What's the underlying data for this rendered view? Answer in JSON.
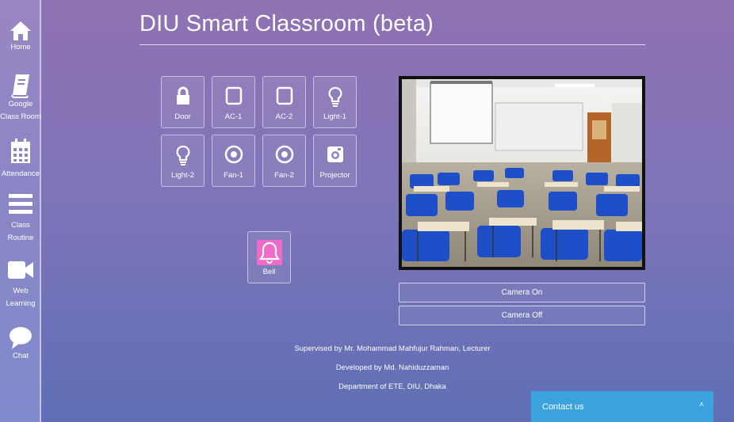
{
  "sidebar": {
    "items": [
      {
        "label": "Home",
        "icon": "home-icon"
      },
      {
        "label": "Google\nClass Room",
        "icon": "notebook-icon"
      },
      {
        "label": "Attendance",
        "icon": "calendar-icon"
      },
      {
        "label": "Class\nRoutine",
        "icon": "menu-icon"
      },
      {
        "label": "Web\nLearning",
        "icon": "video-camera-icon"
      },
      {
        "label": "Chat",
        "icon": "speech-bubble-icon"
      }
    ]
  },
  "header": {
    "title": "DIU Smart Classroom (beta)"
  },
  "controls": {
    "door": "Door",
    "ac1": "AC-1",
    "ac2": "AC-2",
    "light1": "Light-1",
    "light2": "Light-2",
    "fan1": "Fan-1",
    "fan2": "Fan-2",
    "projector": "Projector",
    "bell": "Bell"
  },
  "camera": {
    "on_label": "Camera On",
    "off_label": "Camera Off"
  },
  "credits": {
    "supervised": "Supervised by Mr. Mohammad Mahfujur Rahman, Lecturer",
    "developed": "Developed by Md. Nahiduzzaman",
    "department": "Department of ETE, DIU, Dhaka"
  },
  "contact": {
    "label": "Contact us",
    "caret": "˄"
  },
  "colors": {
    "bell_accent": "#f06ac9",
    "contact_bar": "#3aa3dd",
    "chair_blue": "#1f4fc8"
  }
}
